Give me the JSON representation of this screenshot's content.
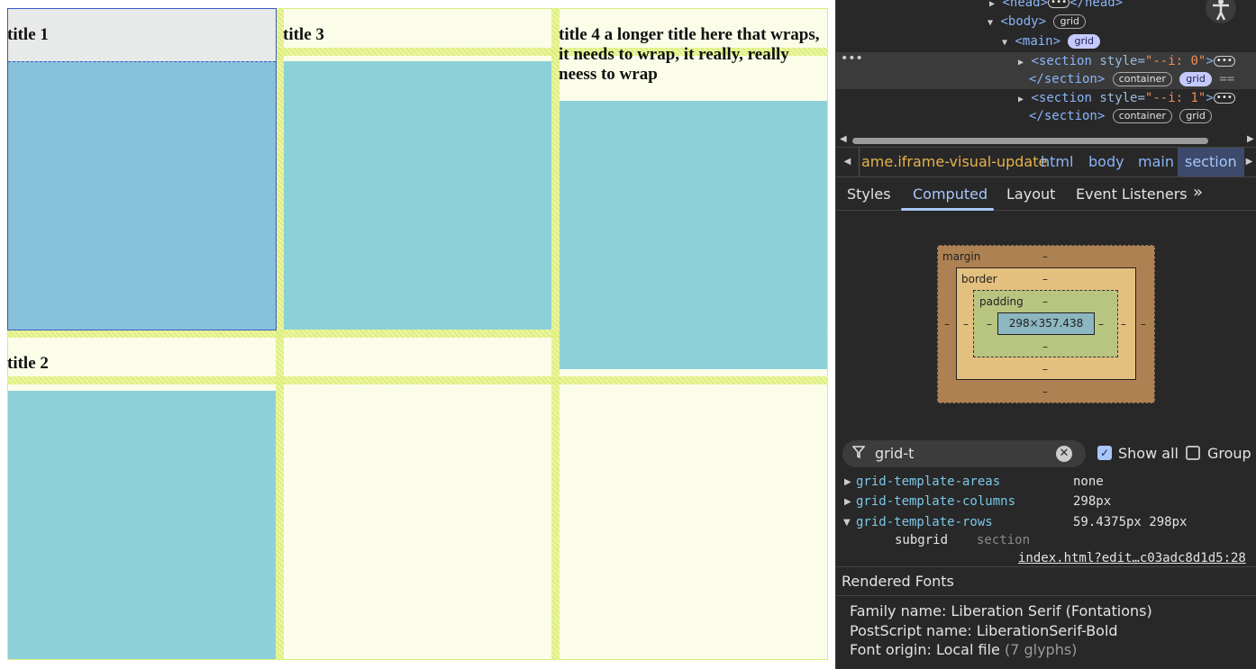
{
  "page": {
    "titles": {
      "t1": "title 1",
      "t2": "title 2",
      "t3": "title 3",
      "t4": "title 4 a longer title here that wraps, it needs to wrap, it really, really neess to wrap"
    }
  },
  "devtools": {
    "tree": {
      "head_open": "<head>",
      "head_close": "</head>",
      "body_open": "<body>",
      "body_badge": "grid",
      "main_open": "<main>",
      "main_badge": "grid",
      "section_tag": "<section",
      "section_close": "</section>",
      "section_attr": "style=",
      "section1_val": "\"--i: 0\"",
      "section2_val": "\"--i: 1\"",
      "close_bracket": ">",
      "badge_container": "container",
      "badge_grid": "grid",
      "equals": "=="
    },
    "breadcrumbs": [
      "ame.iframe-visual-update",
      "html",
      "body",
      "main",
      "section"
    ],
    "tabs": [
      "Styles",
      "Computed",
      "Layout",
      "Event Listeners"
    ],
    "active_tab": "Computed",
    "box_model": {
      "margin_label": "margin",
      "border_label": "border",
      "padding_label": "padding",
      "content_size": "298×357.438",
      "dash": "–"
    },
    "filter": {
      "value": "grid-t",
      "show_all_label": "Show all",
      "show_all_checked": true,
      "group_label": "Group",
      "group_checked": false
    },
    "properties": [
      {
        "name": "grid-template-areas",
        "value": "none"
      },
      {
        "name": "grid-template-columns",
        "value": "298px"
      },
      {
        "name": "grid-template-rows",
        "value": "59.4375px 298px",
        "expanded": true
      }
    ],
    "sub_property": {
      "value": "subgrid",
      "selector": "section",
      "source": "index.html?edit…c03adc8d1d5:28"
    },
    "rendered_fonts": {
      "header": "Rendered Fonts",
      "family": "Family name: Liberation Serif (Fontations)",
      "postscript": "PostScript name: LiberationSerif-Bold",
      "origin": "Font origin: Local file",
      "glyphs": "(7 glyphs)"
    },
    "colors": {
      "accent": "#a8c7fa",
      "tag": "#8ab4f8",
      "prop": "#7cc7e8",
      "background": "#282828"
    },
    "icons": [
      "accessibility-icon",
      "filter-icon",
      "clear-icon",
      "checkbox-icon",
      "overflow-chevron-icon"
    ]
  }
}
